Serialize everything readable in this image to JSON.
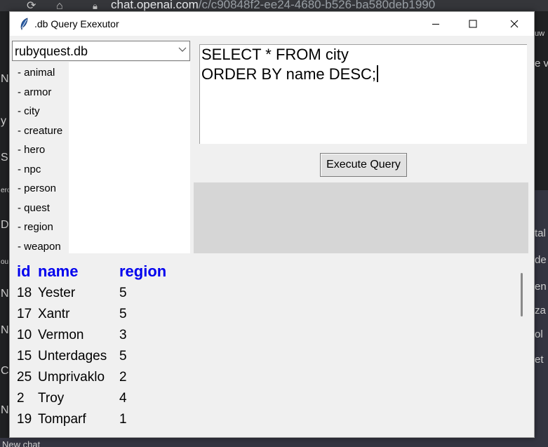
{
  "browser": {
    "url_domain": "chat.openai.com",
    "url_path": "/c/c90848f2-ee24-4680-b526-ba580deb1990",
    "bottom_text": "New chat",
    "left_letters": [
      "N",
      "y",
      "S",
      "ero",
      "D",
      "ou",
      "N",
      "N",
      "C",
      "N"
    ],
    "right_fragments": [
      "uw",
      "e v",
      "tal",
      "de",
      "en",
      "za",
      "ol",
      "et"
    ]
  },
  "window": {
    "title": ".db Query Exexutor",
    "controls": {
      "minimize": "minimize-icon",
      "maximize": "maximize-icon",
      "close": "close-icon"
    }
  },
  "database": {
    "selected": "rubyquest.db"
  },
  "tables": [
    "- animal",
    "- armor",
    "- city",
    "- creature",
    "- hero",
    "- npc",
    "- person",
    "- quest",
    "- region",
    "- weapon"
  ],
  "query": {
    "lines": [
      "SELECT * FROM city",
      "ORDER BY name DESC;"
    ]
  },
  "execute_label": "Execute Query",
  "results": {
    "columns": [
      "id",
      "name",
      "region"
    ],
    "rows": [
      [
        "18",
        "Yester",
        "5"
      ],
      [
        "17",
        "Xantr",
        "5"
      ],
      [
        "10",
        "Vermon",
        "3"
      ],
      [
        "15",
        "Unterdages",
        "5"
      ],
      [
        "25",
        "Umprivaklo",
        "2"
      ],
      [
        "2",
        "Troy",
        "4"
      ],
      [
        "19",
        "Tomparf",
        "1"
      ]
    ]
  },
  "colors": {
    "header_blue": "#0000ee",
    "pane_gray": "#d6d6d6",
    "window_bg": "#f0f0f0"
  }
}
